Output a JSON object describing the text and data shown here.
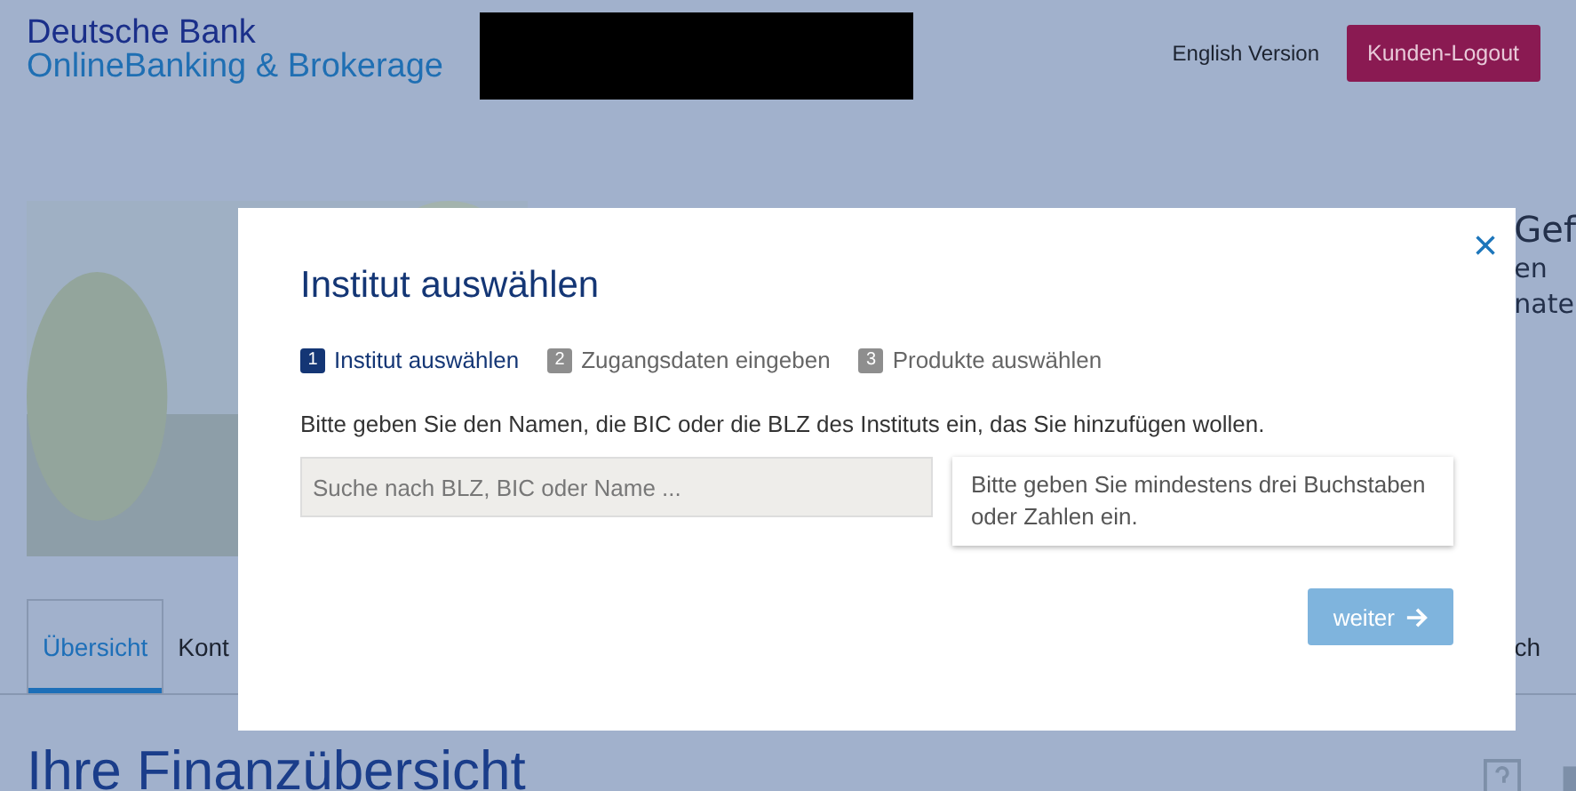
{
  "header": {
    "logo_line1": "Deutsche Bank",
    "logo_line2": "OnlineBanking & Brokerage",
    "language_link": "English Version",
    "logout_button": "Kunden-Logout"
  },
  "hero": {
    "title": "Gef",
    "lines": [
      "en",
      "nate"
    ]
  },
  "tabs": [
    {
      "label": "Übersicht",
      "selected": true
    },
    {
      "label": "Kont",
      "selected": false
    },
    {
      "label": "ch",
      "selected": false
    }
  ],
  "page_title": "Ihre Finanzübersicht",
  "dialog": {
    "title": "Institut auswählen",
    "close": "×",
    "steps": [
      {
        "number": "1",
        "label": "Institut auswählen",
        "selected": true
      },
      {
        "number": "2",
        "label": "Zugangsdaten eingeben",
        "selected": false
      },
      {
        "number": "3",
        "label": "Produkte auswählen",
        "selected": false
      }
    ],
    "instruction": "Bitte geben Sie den Namen, die BIC oder die BLZ des Instituts ein, das Sie hinzufügen wollen.",
    "search": {
      "placeholder": "Suche nach BLZ, BIC oder Name ..."
    },
    "hint": "Bitte geben Sie mindestens drei Buchstaben oder Zahlen ein.",
    "next_button": {
      "label": "weiter",
      "disabled": true
    }
  }
}
